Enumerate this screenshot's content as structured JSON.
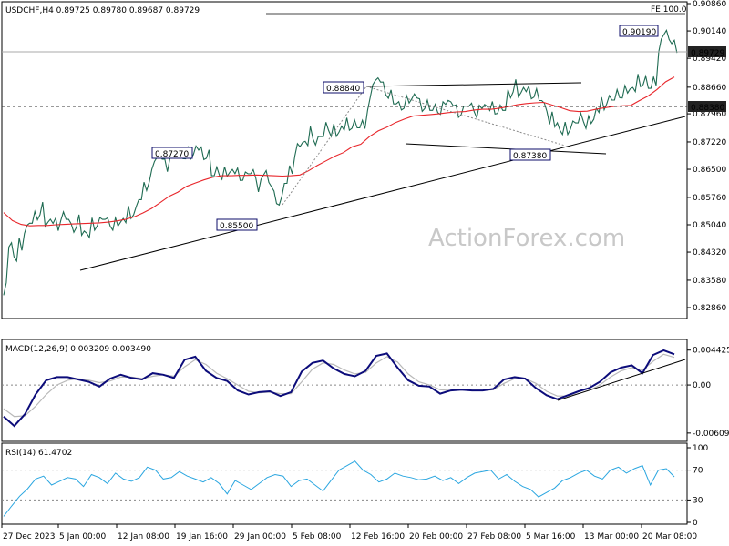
{
  "colors": {
    "price": "#1f6b52",
    "ema": "#e8262b",
    "macd": "#0c0c7a",
    "signal": "#b9b9b9",
    "rsi": "#2aa6e0",
    "trend": "#000000",
    "fib_line": "#8a8a8a",
    "box_text": "#0c0c6a"
  },
  "watermark": "ActionForex.com",
  "main": {
    "header": "USDCHF,H4  0.89725  0.89780  0.89687  0.89729",
    "fe_label": "FE 100.0",
    "current_price": "0.89729",
    "level_label": "0.88380",
    "y_ticks": [
      "0.90860",
      "0.90140",
      "0.89420",
      "0.88660",
      "0.87960",
      "0.87220",
      "0.86500",
      "0.85760",
      "0.85040",
      "0.84320",
      "0.83580",
      "0.82860"
    ],
    "pivots": [
      "0.90190",
      "0.88840",
      "0.87270",
      "0.87380",
      "0.85500"
    ]
  },
  "macd": {
    "header": "MACD(12,26,9) 0.003209 0.003490",
    "ticks": [
      "0.004425",
      "0.00",
      "-0.006092"
    ]
  },
  "rsi": {
    "header": "RSI(14) 61.4702",
    "ticks": [
      "100",
      "70",
      "30",
      "0"
    ]
  },
  "x_ticks": [
    "27 Dec 2023",
    "5 Jan 00:00",
    "12 Jan 08:00",
    "19 Jan 16:00",
    "29 Jan 00:00",
    "5 Feb 08:00",
    "12 Feb 16:00",
    "20 Feb 00:00",
    "27 Feb 08:00",
    "5 Mar 16:00",
    "13 Mar 00:00",
    "20 Mar 08:00"
  ],
  "chart_data": [
    {
      "type": "line",
      "title": "USDCHF,H4",
      "y_ticks": [
        0.9086,
        0.9014,
        0.8942,
        0.8866,
        0.8796,
        0.8722,
        0.865,
        0.8576,
        0.8504,
        0.8432,
        0.8358,
        0.8286
      ],
      "ylim": [
        0.8286,
        0.9086
      ],
      "series": [
        {
          "name": "price",
          "values": [
            0.8335,
            0.8451,
            0.8414,
            0.8453,
            0.8492,
            0.8508,
            0.8528,
            0.8547,
            0.8505,
            0.8513,
            0.8505,
            0.8527,
            0.8518,
            0.8495,
            0.8514,
            0.8482,
            0.8476,
            0.8506,
            0.8512,
            0.8518,
            0.8511,
            0.8506,
            0.8506,
            0.8515,
            0.8537,
            0.8541,
            0.857,
            0.8605,
            0.8633,
            0.8676,
            0.8682,
            0.866,
            0.8691,
            0.868,
            0.8689,
            0.8694,
            0.8683,
            0.8706,
            0.8692,
            0.869,
            0.8633,
            0.8645,
            0.864,
            0.8637,
            0.8644,
            0.8637,
            0.8632,
            0.8638,
            0.8638,
            0.8607,
            0.8641,
            0.861,
            0.8576,
            0.8567,
            0.8613,
            0.8649,
            0.8701,
            0.8715,
            0.8718,
            0.8746,
            0.8725,
            0.8736,
            0.8763,
            0.8753,
            0.8742,
            0.8758,
            0.8769,
            0.8769,
            0.8759,
            0.8768,
            0.8822,
            0.8878,
            0.8885,
            0.8863,
            0.8848,
            0.8822,
            0.8817,
            0.8827,
            0.883,
            0.8843,
            0.8819,
            0.8821,
            0.8805,
            0.881,
            0.8811,
            0.8826,
            0.8822,
            0.8803,
            0.8805,
            0.8816,
            0.8813,
            0.8802,
            0.8815,
            0.881,
            0.8812,
            0.8808,
            0.8805,
            0.8849,
            0.887,
            0.8846,
            0.886,
            0.8852,
            0.8851,
            0.8831,
            0.8813,
            0.8785,
            0.8767,
            0.8747,
            0.8758,
            0.8766,
            0.8772,
            0.8787,
            0.8774,
            0.8776,
            0.8805,
            0.8823,
            0.8833,
            0.8832,
            0.8849,
            0.8854,
            0.8856,
            0.886,
            0.8884,
            0.8884,
            0.8863,
            0.8882,
            0.8976,
            0.901,
            0.8986,
            0.8973
          ]
        },
        {
          "name": "EMA",
          "values": [
            0.8536,
            0.8515,
            0.8505,
            0.8501,
            0.8502,
            0.8502,
            0.8504,
            0.8505,
            0.8506,
            0.8507,
            0.8508,
            0.8509,
            0.8511,
            0.8514,
            0.8518,
            0.8525,
            0.8535,
            0.8547,
            0.8563,
            0.8579,
            0.859,
            0.8605,
            0.8614,
            0.8622,
            0.8629,
            0.8633,
            0.8633,
            0.8634,
            0.8634,
            0.8635,
            0.8634,
            0.8633,
            0.8632,
            0.8633,
            0.8635,
            0.8646,
            0.866,
            0.8672,
            0.8684,
            0.8694,
            0.8709,
            0.8716,
            0.8736,
            0.8751,
            0.8761,
            0.8773,
            0.8782,
            0.879,
            0.8792,
            0.8794,
            0.8796,
            0.8799,
            0.8801,
            0.8802,
            0.8806,
            0.8808,
            0.8808,
            0.8811,
            0.8815,
            0.882,
            0.8823,
            0.8825,
            0.8826,
            0.8819,
            0.8812,
            0.8804,
            0.8802,
            0.8803,
            0.8808,
            0.8812,
            0.8815,
            0.8817,
            0.8818,
            0.8831,
            0.8843,
            0.886,
            0.888,
            0.8893
          ]
        }
      ]
    },
    {
      "type": "line",
      "title": "MACD(12,26,9)",
      "y_ticks": [
        0.004425,
        0.0,
        -0.006092
      ],
      "ylim": [
        -0.0068,
        0.0052
      ],
      "series": [
        {
          "name": "MACD",
          "values": [
            -0.004,
            -0.0052,
            -0.0037,
            -0.0012,
            0.0006,
            0.001,
            0.001,
            0.0007,
            0.0004,
            -0.0002,
            0.0008,
            0.0013,
            0.0009,
            0.0007,
            0.0015,
            0.0013,
            0.0009,
            0.0032,
            0.0036,
            0.0018,
            0.0009,
            0.0005,
            -0.0007,
            -0.0012,
            -0.0009,
            -0.0008,
            -0.0014,
            -0.0009,
            0.0017,
            0.0028,
            0.0031,
            0.0021,
            0.0014,
            0.0011,
            0.0018,
            0.0037,
            0.004,
            0.0022,
            0.0006,
            -0.0001,
            -0.0002,
            -0.0011,
            -0.0007,
            -0.0006,
            -0.0007,
            -0.0007,
            -0.0005,
            0.0007,
            0.001,
            0.0008,
            -0.0004,
            -0.0013,
            -0.0018,
            -0.0013,
            -0.0008,
            -0.0004,
            0.0004,
            0.0016,
            0.0022,
            0.0025,
            0.0015,
            0.0038,
            0.0044,
            0.0039
          ]
        },
        {
          "name": "Signal",
          "values": [
            -0.003,
            -0.004,
            -0.0039,
            -0.0027,
            -0.0012,
            0.0,
            0.0006,
            0.0008,
            0.0006,
            0.0003,
            0.0005,
            0.001,
            0.001,
            0.0008,
            0.0011,
            0.0013,
            0.0011,
            0.0023,
            0.0032,
            0.0026,
            0.0015,
            0.0008,
            0.0,
            -0.0008,
            -0.001,
            -0.0009,
            -0.0011,
            -0.0011,
            0.0004,
            0.002,
            0.0028,
            0.0026,
            0.0019,
            0.0014,
            0.0016,
            0.0028,
            0.0036,
            0.0029,
            0.0014,
            0.0004,
            0.0,
            -0.0006,
            -0.0007,
            -0.0006,
            -0.0007,
            -0.0007,
            -0.0006,
            0.0002,
            0.0008,
            0.0008,
            0.0002,
            -0.0008,
            -0.0014,
            -0.0014,
            -0.0011,
            -0.0007,
            0.0,
            0.001,
            0.0018,
            0.0022,
            0.0019,
            0.003,
            0.0039,
            0.0035
          ]
        }
      ]
    },
    {
      "type": "line",
      "title": "RSI(14)",
      "y_ticks": [
        100,
        70,
        30,
        0
      ],
      "ylim": [
        0,
        100
      ],
      "series": [
        {
          "name": "RSI",
          "values": [
            8,
            22,
            35,
            45,
            58,
            62,
            50,
            55,
            60,
            58,
            48,
            64,
            60,
            52,
            66,
            58,
            55,
            60,
            74,
            70,
            58,
            60,
            68,
            62,
            58,
            54,
            60,
            52,
            38,
            56,
            50,
            44,
            52,
            60,
            64,
            62,
            48,
            56,
            58,
            50,
            42,
            56,
            70,
            76,
            82,
            70,
            64,
            54,
            58,
            66,
            62,
            60,
            57,
            58,
            62,
            56,
            60,
            52,
            60,
            66,
            68,
            70,
            58,
            64,
            55,
            48,
            44,
            34,
            40,
            46,
            56,
            60,
            66,
            70,
            62,
            58,
            70,
            74,
            66,
            72,
            76,
            50,
            70,
            72,
            61
          ]
        }
      ]
    }
  ]
}
